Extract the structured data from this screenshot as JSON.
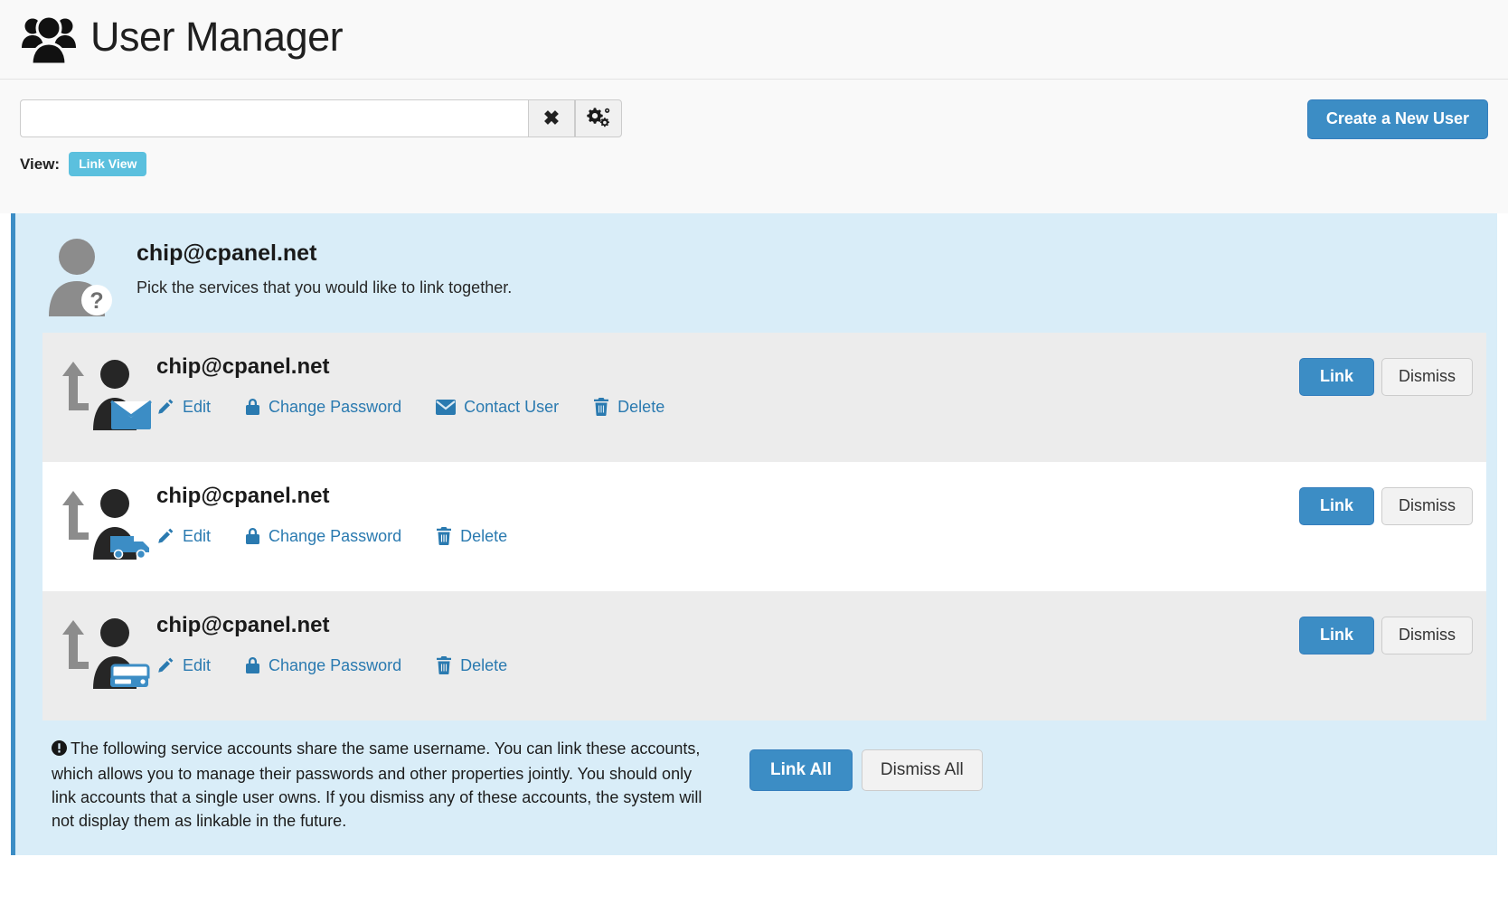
{
  "header": {
    "title": "User Manager",
    "logo_icon": "users-group-icon"
  },
  "toolbar": {
    "search_value": "",
    "search_placeholder": "",
    "clear_icon": "close-x-icon",
    "settings_icon": "gears-icon",
    "view_label": "View:",
    "view_badge": "Link View",
    "create_user_label": "Create a New User"
  },
  "panel": {
    "avatar_icon": "user-unknown-avatar-icon",
    "username": "chip@cpanel.net",
    "instruction": "Pick the services that you would like to link together.",
    "accent_color": "#3c8dc5",
    "background_color": "#d9edf8"
  },
  "rows": [
    {
      "username": "chip@cpanel.net",
      "service_icon": "user-email-service-icon",
      "link_arrow_icon": "link-up-arrow-icon",
      "actions": [
        {
          "label": "Edit",
          "icon": "pencil-icon"
        },
        {
          "label": "Change Password",
          "icon": "lock-icon"
        },
        {
          "label": "Contact User",
          "icon": "envelope-icon"
        },
        {
          "label": "Delete",
          "icon": "trash-icon"
        }
      ],
      "link_label": "Link",
      "dismiss_label": "Dismiss",
      "shaded": true
    },
    {
      "username": "chip@cpanel.net",
      "service_icon": "user-ftp-service-icon",
      "link_arrow_icon": "link-up-arrow-icon",
      "actions": [
        {
          "label": "Edit",
          "icon": "pencil-icon"
        },
        {
          "label": "Change Password",
          "icon": "lock-icon"
        },
        {
          "label": "Delete",
          "icon": "trash-icon"
        }
      ],
      "link_label": "Link",
      "dismiss_label": "Dismiss",
      "shaded": false
    },
    {
      "username": "chip@cpanel.net",
      "service_icon": "user-disk-service-icon",
      "link_arrow_icon": "link-up-arrow-icon",
      "actions": [
        {
          "label": "Edit",
          "icon": "pencil-icon"
        },
        {
          "label": "Change Password",
          "icon": "lock-icon"
        },
        {
          "label": "Delete",
          "icon": "trash-icon"
        }
      ],
      "link_label": "Link",
      "dismiss_label": "Dismiss",
      "shaded": true
    }
  ],
  "footer": {
    "notice_icon": "exclamation-circle-icon",
    "notice": "The following service accounts share the same username. You can link these accounts, which allows you to manage their passwords and other properties jointly. You should only link accounts that a single user owns. If you dismiss any of these accounts, the system will not display them as linkable in the future.",
    "link_all_label": "Link All",
    "dismiss_all_label": "Dismiss All"
  }
}
